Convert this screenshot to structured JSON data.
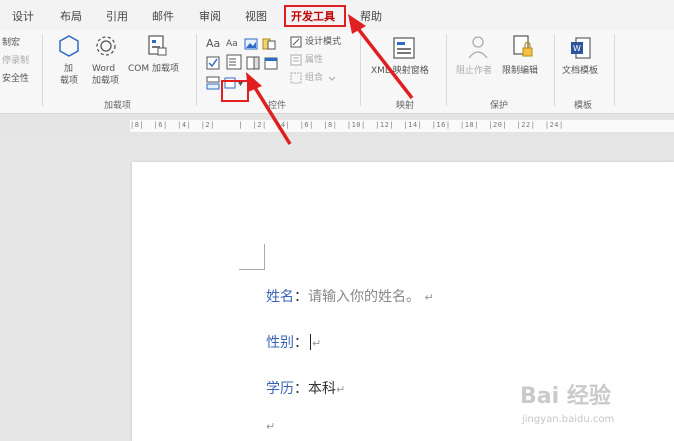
{
  "tabs": [
    {
      "label": "设计",
      "active": false
    },
    {
      "label": "布局",
      "active": false
    },
    {
      "label": "引用",
      "active": false
    },
    {
      "label": "邮件",
      "active": false
    },
    {
      "label": "审阅",
      "active": false
    },
    {
      "label": "视图",
      "active": false
    },
    {
      "label": "开发工具",
      "active": true
    },
    {
      "label": "帮助",
      "active": false
    }
  ],
  "ribbon": {
    "code": {
      "macro": "制宏",
      "record": "停录制",
      "security": "安全性"
    },
    "addins": {
      "addin_line1": "加",
      "addin_line2": "载项",
      "word_line1": "Word",
      "word_line2": "加载项",
      "com": "COM 加载项",
      "group": "加载项"
    },
    "controls": {
      "design_mode": "设计模式",
      "properties": "属性",
      "group_btn": "组合",
      "group": "控件",
      "aa_large": "Aa",
      "aa_small": "Aa"
    },
    "mapping": {
      "xml": "XML 映射窗格",
      "group": "映射"
    },
    "protect": {
      "block": "阻止作者",
      "restrict": "限制编辑",
      "group": "保护"
    },
    "templates": {
      "doc_template": "文档模板",
      "group": "模板"
    }
  },
  "ruler": {
    "ticks": "|8|  |6|  |4|  |2|     |  |2|  |4|  |6|  |8|  |10|  |12|  |14|  |16|  |18|  |20|  |22|  |24|"
  },
  "document": {
    "lines": [
      {
        "label": "姓名",
        "colon": "：",
        "value": "请输入你的姓名。",
        "mark": "↵"
      },
      {
        "label": "性别",
        "colon": "：",
        "value": "",
        "mark": "↵"
      },
      {
        "label": "学历",
        "colon": "：",
        "value": "本科",
        "mark": "↵"
      }
    ],
    "trailing_mark": "↵"
  },
  "watermark": {
    "brand": "Bai 经验",
    "url": "jingyan.baidu.com"
  },
  "colors": {
    "accent": "#c00000",
    "highlight": "#e02020",
    "label_blue": "#3a63b8"
  }
}
